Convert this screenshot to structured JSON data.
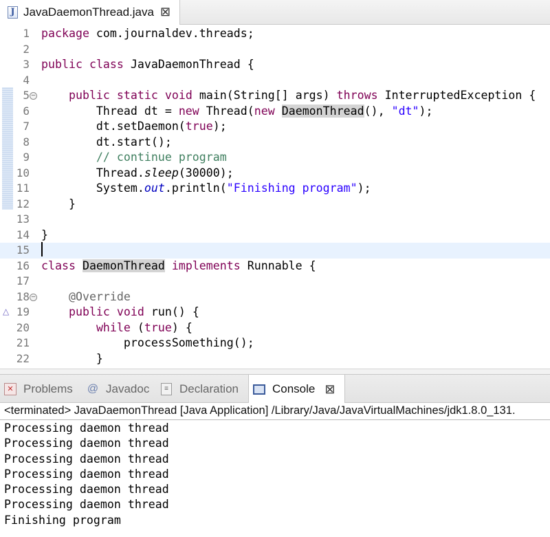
{
  "editor_tab": {
    "label": "JavaDaemonThread.java",
    "icon_letter": "J",
    "close_glyph": "⊠"
  },
  "editor": {
    "lines": [
      {
        "num": "1",
        "parts": [
          {
            "t": "package",
            "c": "kw"
          },
          {
            "t": " com.journaldev.threads;"
          }
        ]
      },
      {
        "num": "2",
        "parts": []
      },
      {
        "num": "3",
        "parts": [
          {
            "t": "public",
            "c": "kw"
          },
          {
            "t": " "
          },
          {
            "t": "class",
            "c": "kw"
          },
          {
            "t": " JavaDaemonThread {"
          }
        ]
      },
      {
        "num": "4",
        "parts": []
      },
      {
        "num": "5",
        "parts": [
          {
            "t": "    "
          },
          {
            "t": "public",
            "c": "kw"
          },
          {
            "t": " "
          },
          {
            "t": "static",
            "c": "kw"
          },
          {
            "t": " "
          },
          {
            "t": "void",
            "c": "kw"
          },
          {
            "t": " main(String[] args) "
          },
          {
            "t": "throws",
            "c": "kw"
          },
          {
            "t": " InterruptedException {"
          }
        ]
      },
      {
        "num": "6",
        "parts": [
          {
            "t": "        Thread dt = "
          },
          {
            "t": "new",
            "c": "kw"
          },
          {
            "t": " Thread("
          },
          {
            "t": "new",
            "c": "kw"
          },
          {
            "t": " "
          },
          {
            "t": "DaemonThread",
            "c": "occ"
          },
          {
            "t": "(), "
          },
          {
            "t": "\"dt\"",
            "c": "str"
          },
          {
            "t": ");"
          }
        ]
      },
      {
        "num": "7",
        "parts": [
          {
            "t": "        dt.setDaemon("
          },
          {
            "t": "true",
            "c": "kw"
          },
          {
            "t": ");"
          }
        ]
      },
      {
        "num": "8",
        "parts": [
          {
            "t": "        dt.start();"
          }
        ]
      },
      {
        "num": "9",
        "parts": [
          {
            "t": "        "
          },
          {
            "t": "// continue program",
            "c": "cm"
          }
        ]
      },
      {
        "num": "10",
        "parts": [
          {
            "t": "        Thread."
          },
          {
            "t": "sleep",
            "c": "it"
          },
          {
            "t": "(30000);"
          }
        ]
      },
      {
        "num": "11",
        "parts": [
          {
            "t": "        System."
          },
          {
            "t": "out",
            "c": "fld"
          },
          {
            "t": ".println("
          },
          {
            "t": "\"Finishing program\"",
            "c": "str"
          },
          {
            "t": ");"
          }
        ]
      },
      {
        "num": "12",
        "parts": [
          {
            "t": "    }"
          }
        ]
      },
      {
        "num": "13",
        "parts": []
      },
      {
        "num": "14",
        "parts": [
          {
            "t": "}"
          }
        ]
      },
      {
        "num": "15",
        "parts": []
      },
      {
        "num": "16",
        "parts": [
          {
            "t": "class",
            "c": "kw"
          },
          {
            "t": " "
          },
          {
            "t": "DaemonThread",
            "c": "occ"
          },
          {
            "t": " "
          },
          {
            "t": "implements",
            "c": "kw"
          },
          {
            "t": " Runnable {"
          }
        ]
      },
      {
        "num": "17",
        "parts": []
      },
      {
        "num": "18",
        "parts": [
          {
            "t": "    "
          },
          {
            "t": "@Override",
            "c": "ann"
          }
        ]
      },
      {
        "num": "19",
        "parts": [
          {
            "t": "    "
          },
          {
            "t": "public",
            "c": "kw"
          },
          {
            "t": " "
          },
          {
            "t": "void",
            "c": "kw"
          },
          {
            "t": " run() {"
          }
        ]
      },
      {
        "num": "20",
        "parts": [
          {
            "t": "        "
          },
          {
            "t": "while",
            "c": "kw"
          },
          {
            "t": " ("
          },
          {
            "t": "true",
            "c": "kw"
          },
          {
            "t": ") {"
          }
        ]
      },
      {
        "num": "21",
        "parts": [
          {
            "t": "            processSomething();"
          }
        ]
      },
      {
        "num": "22",
        "parts": [
          {
            "t": "        }"
          }
        ]
      }
    ],
    "current_line": "15",
    "fold_lines": [
      "5",
      "18"
    ],
    "override_marker_line": "19"
  },
  "panel_tabs": {
    "problems": "Problems",
    "javadoc": "Javadoc",
    "declaration": "Declaration",
    "console": "Console",
    "close_glyph": "⊠",
    "javadoc_icon": "@"
  },
  "console": {
    "status": "<terminated> JavaDaemonThread [Java Application] /Library/Java/JavaVirtualMachines/jdk1.8.0_131.",
    "output": [
      "Processing daemon thread",
      "Processing daemon thread",
      "Processing daemon thread",
      "Processing daemon thread",
      "Processing daemon thread",
      "Processing daemon thread",
      "Finishing program"
    ]
  },
  "colors": {
    "keyword": "#7f0055",
    "string": "#2a00ff",
    "comment": "#3f7f5f",
    "field": "#0000c0",
    "annotation": "#646464",
    "current_line_bg": "#e8f2fe",
    "occurrence_bg": "#d4d4d4"
  },
  "icons": {
    "editor_tab": "java-file-icon",
    "problems": "problems-icon",
    "javadoc": "javadoc-at-icon",
    "declaration": "declaration-icon",
    "console": "console-icon",
    "fold": "fold-collapse-icon",
    "override": "override-triangle-icon"
  }
}
